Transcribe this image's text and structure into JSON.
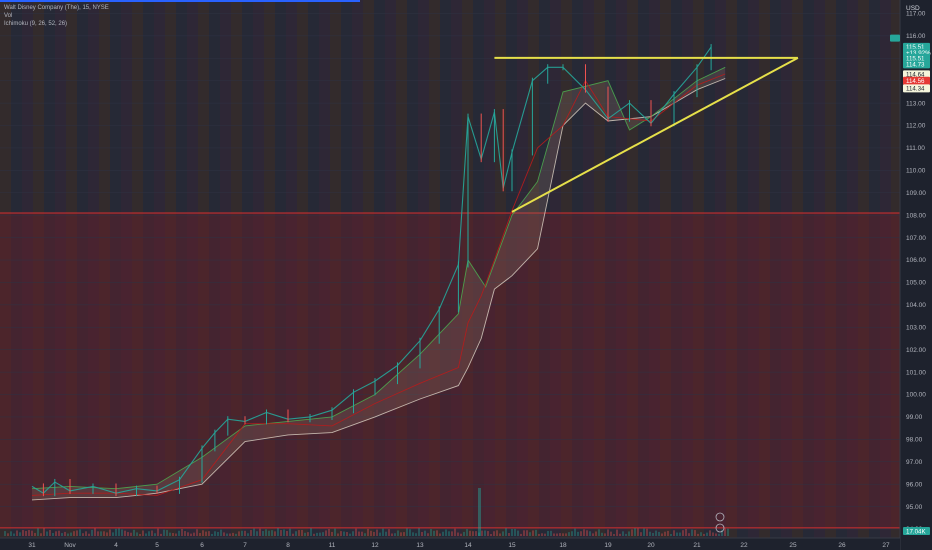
{
  "chart_data": {
    "type": "candlestick",
    "symbol_title": "Walt Disney Company (The), 15, NYSE",
    "legend": [
      "Vol",
      "Ichimoku (9, 26, 52, 26)"
    ],
    "currency": "USD",
    "ylim": [
      93.6,
      117.6
    ],
    "y_ticks": [
      "117.00",
      "116.00",
      "115.00",
      "114.00",
      "113.00",
      "112.00",
      "111.00",
      "110.00",
      "109.00",
      "108.00",
      "107.00",
      "106.00",
      "105.00",
      "104.00",
      "103.00",
      "102.00",
      "101.00",
      "100.00",
      "99.00",
      "98.00",
      "97.00",
      "96.00",
      "95.00",
      "94.00"
    ],
    "x_ticks": [
      "31",
      "Nov",
      "4",
      "5",
      "6",
      "7",
      "8",
      "11",
      "12",
      "13",
      "14",
      "15",
      "18",
      "19",
      "20",
      "21",
      "22",
      "25",
      "26",
      "27"
    ],
    "price_labels": [
      {
        "text": "115.51",
        "value": 115.51,
        "color": "#26a69a"
      },
      {
        "text": "+13.92%",
        "value": 115.25,
        "color": "#26a69a"
      },
      {
        "text": "06:58",
        "value": 115.02,
        "color": "#26a69a"
      },
      {
        "text": "115.51",
        "value": 115.0,
        "color": "#26a69a"
      },
      {
        "text": "114.73",
        "value": 114.73,
        "color": "#26a69a"
      },
      {
        "text": "114.64",
        "value": 114.28,
        "color": "#f5f5dc"
      },
      {
        "text": "114.56",
        "value": 114.0,
        "color": "#e53935"
      },
      {
        "text": "114.34",
        "value": 113.66,
        "color": "#f5f5dc"
      }
    ],
    "volume_label": "17.04K",
    "horizontal_lines": [
      108.1,
      94.05
    ],
    "resistance_line": {
      "x1": "14.6",
      "y1": 115.02,
      "x2": "25.1",
      "y2": 115.02,
      "color": "#e6e04a"
    },
    "support_line": {
      "x1": "15.0",
      "y1": 108.15,
      "x2": "25.1",
      "y2": 115.02,
      "color": "#e6e04a"
    },
    "price_path": [
      [
        "31",
        95.9
      ],
      [
        "31.3",
        95.6
      ],
      [
        "31.6",
        96.1
      ],
      [
        "Nov",
        95.7
      ],
      [
        "Nov.5",
        95.9
      ],
      [
        "4",
        95.6
      ],
      [
        "4.5",
        95.8
      ],
      [
        "5",
        95.7
      ],
      [
        "5.5",
        96.2
      ],
      [
        "6",
        97.6
      ],
      [
        "6.3",
        98.3
      ],
      [
        "6.6",
        98.9
      ],
      [
        "7",
        98.8
      ],
      [
        "7.5",
        99.2
      ],
      [
        "8",
        98.9
      ],
      [
        "8.5",
        99.0
      ],
      [
        "11",
        99.3
      ],
      [
        "11.5",
        100.1
      ],
      [
        "12",
        100.6
      ],
      [
        "12.5",
        101.3
      ],
      [
        "13",
        102.4
      ],
      [
        "13.4",
        103.8
      ],
      [
        "13.8",
        105.8
      ],
      [
        "14",
        112.4
      ],
      [
        "14.3",
        110.5
      ],
      [
        "14.6",
        112.6
      ],
      [
        "14.8",
        109.2
      ],
      [
        "15",
        110.8
      ],
      [
        "15.4",
        114.0
      ],
      [
        "15.7",
        114.6
      ],
      [
        "18",
        114.6
      ],
      [
        "18.5",
        113.6
      ],
      [
        "19",
        112.3
      ],
      [
        "19.5",
        113.0
      ],
      [
        "20",
        112.1
      ],
      [
        "20.5",
        113.4
      ],
      [
        "21",
        114.6
      ],
      [
        "21.3",
        115.5
      ]
    ],
    "kijun_path": [
      [
        "31",
        95.5
      ],
      [
        "Nov",
        95.6
      ],
      [
        "4",
        95.6
      ],
      [
        "5",
        95.5
      ],
      [
        "6",
        96.2
      ],
      [
        "7",
        98.7
      ],
      [
        "8",
        98.7
      ],
      [
        "11",
        98.6
      ],
      [
        "12",
        99.6
      ],
      [
        "13",
        100.5
      ],
      [
        "13.8",
        101.2
      ],
      [
        "14",
        103.2
      ],
      [
        "14.3",
        104.4
      ],
      [
        "14.6",
        106.0
      ],
      [
        "15",
        108.2
      ],
      [
        "15.5",
        111.0
      ],
      [
        "18",
        112.0
      ],
      [
        "18.5",
        114.0
      ],
      [
        "19",
        112.4
      ],
      [
        "20",
        112.2
      ],
      [
        "21",
        113.8
      ],
      [
        "21.6",
        114.3
      ]
    ],
    "span_a_path": [
      [
        "31",
        95.8
      ],
      [
        "Nov",
        95.9
      ],
      [
        "4",
        95.8
      ],
      [
        "5",
        96.0
      ],
      [
        "6",
        97.2
      ],
      [
        "7",
        98.6
      ],
      [
        "8",
        98.8
      ],
      [
        "11",
        99.0
      ],
      [
        "12",
        100.0
      ],
      [
        "13",
        101.8
      ],
      [
        "13.8",
        103.6
      ],
      [
        "14",
        106.0
      ],
      [
        "14.4",
        104.8
      ],
      [
        "15",
        108.0
      ],
      [
        "15.5",
        109.5
      ],
      [
        "18",
        113.5
      ],
      [
        "19",
        114.0
      ],
      [
        "19.5",
        111.8
      ],
      [
        "20",
        112.4
      ],
      [
        "21",
        114.0
      ],
      [
        "21.6",
        114.6
      ]
    ],
    "span_b_path": [
      [
        "31",
        95.3
      ],
      [
        "Nov",
        95.4
      ],
      [
        "4",
        95.4
      ],
      [
        "5",
        95.6
      ],
      [
        "6",
        96.0
      ],
      [
        "7",
        97.9
      ],
      [
        "8",
        98.2
      ],
      [
        "11",
        98.3
      ],
      [
        "12",
        99.0
      ],
      [
        "13",
        99.8
      ],
      [
        "13.8",
        100.4
      ],
      [
        "14",
        101.2
      ],
      [
        "14.3",
        102.5
      ],
      [
        "14.6",
        104.7
      ],
      [
        "15",
        105.3
      ],
      [
        "15.5",
        106.5
      ],
      [
        "18",
        112.0
      ],
      [
        "18.5",
        113.0
      ],
      [
        "19",
        112.2
      ],
      [
        "20",
        112.4
      ],
      [
        "21",
        113.6
      ],
      [
        "21.6",
        114.1
      ]
    ],
    "volume_spike_date": "14"
  }
}
